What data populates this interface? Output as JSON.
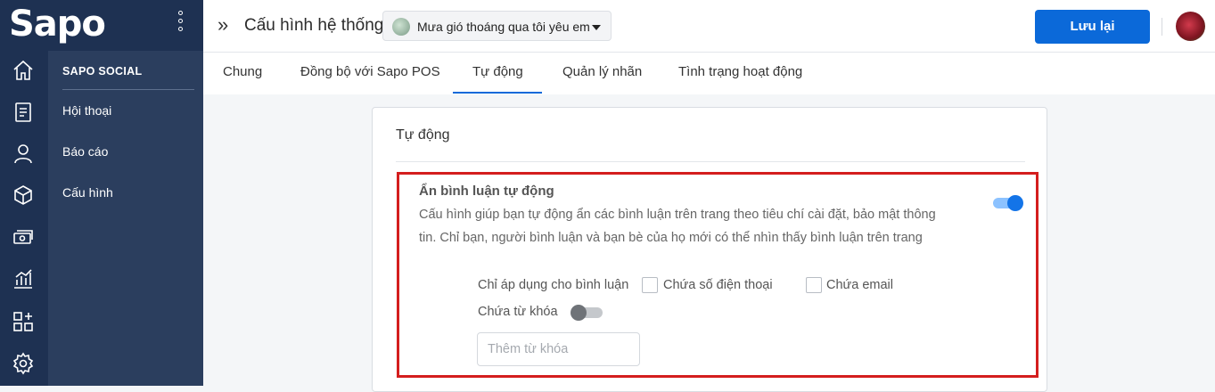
{
  "brand": {
    "logo_text": "Sapo"
  },
  "rail_icons": [
    "home-icon",
    "order-icon",
    "customer-icon",
    "product-icon",
    "payment-icon",
    "report-icon",
    "apps-icon",
    "settings-icon"
  ],
  "sidebar": {
    "section": "SAPO SOCIAL",
    "items": [
      {
        "label": "Hội thoại"
      },
      {
        "label": "Báo cáo"
      },
      {
        "label": "Cấu hình"
      }
    ]
  },
  "header": {
    "title": "Cấu hình hệ thống",
    "page_selector": "Mưa gió thoáng qua tôi yêu em",
    "save_label": "Lưu lại"
  },
  "tabs": [
    {
      "label": "Chung"
    },
    {
      "label": "Đồng bộ với Sapo POS"
    },
    {
      "label": "Tự động",
      "active": true
    },
    {
      "label": "Quản lý nhãn"
    },
    {
      "label": "Tình trạng hoạt động"
    }
  ],
  "main": {
    "card_title": "Tự động",
    "auto_hide": {
      "title": "Ẩn bình luận tự động",
      "description": "Cấu hình giúp bạn tự động ẩn các bình luận trên trang theo tiêu chí cài đặt, bảo mật thông tin. Chỉ bạn, người bình luận và bạn bè của họ mới có thể nhìn thấy bình luận trên trang",
      "enabled": true,
      "apply_label": "Chỉ áp dụng cho bình luận",
      "phone_label": "Chứa số điện thoại",
      "email_label": "Chứa email",
      "keyword_label": "Chứa từ khóa",
      "keyword_enabled": false,
      "keyword_placeholder": "Thêm từ khóa"
    }
  },
  "colors": {
    "sidebar": "#1e3152",
    "subnav": "#2b3e5e",
    "primary": "#0b69d9",
    "highlight": "#d41e1e"
  }
}
